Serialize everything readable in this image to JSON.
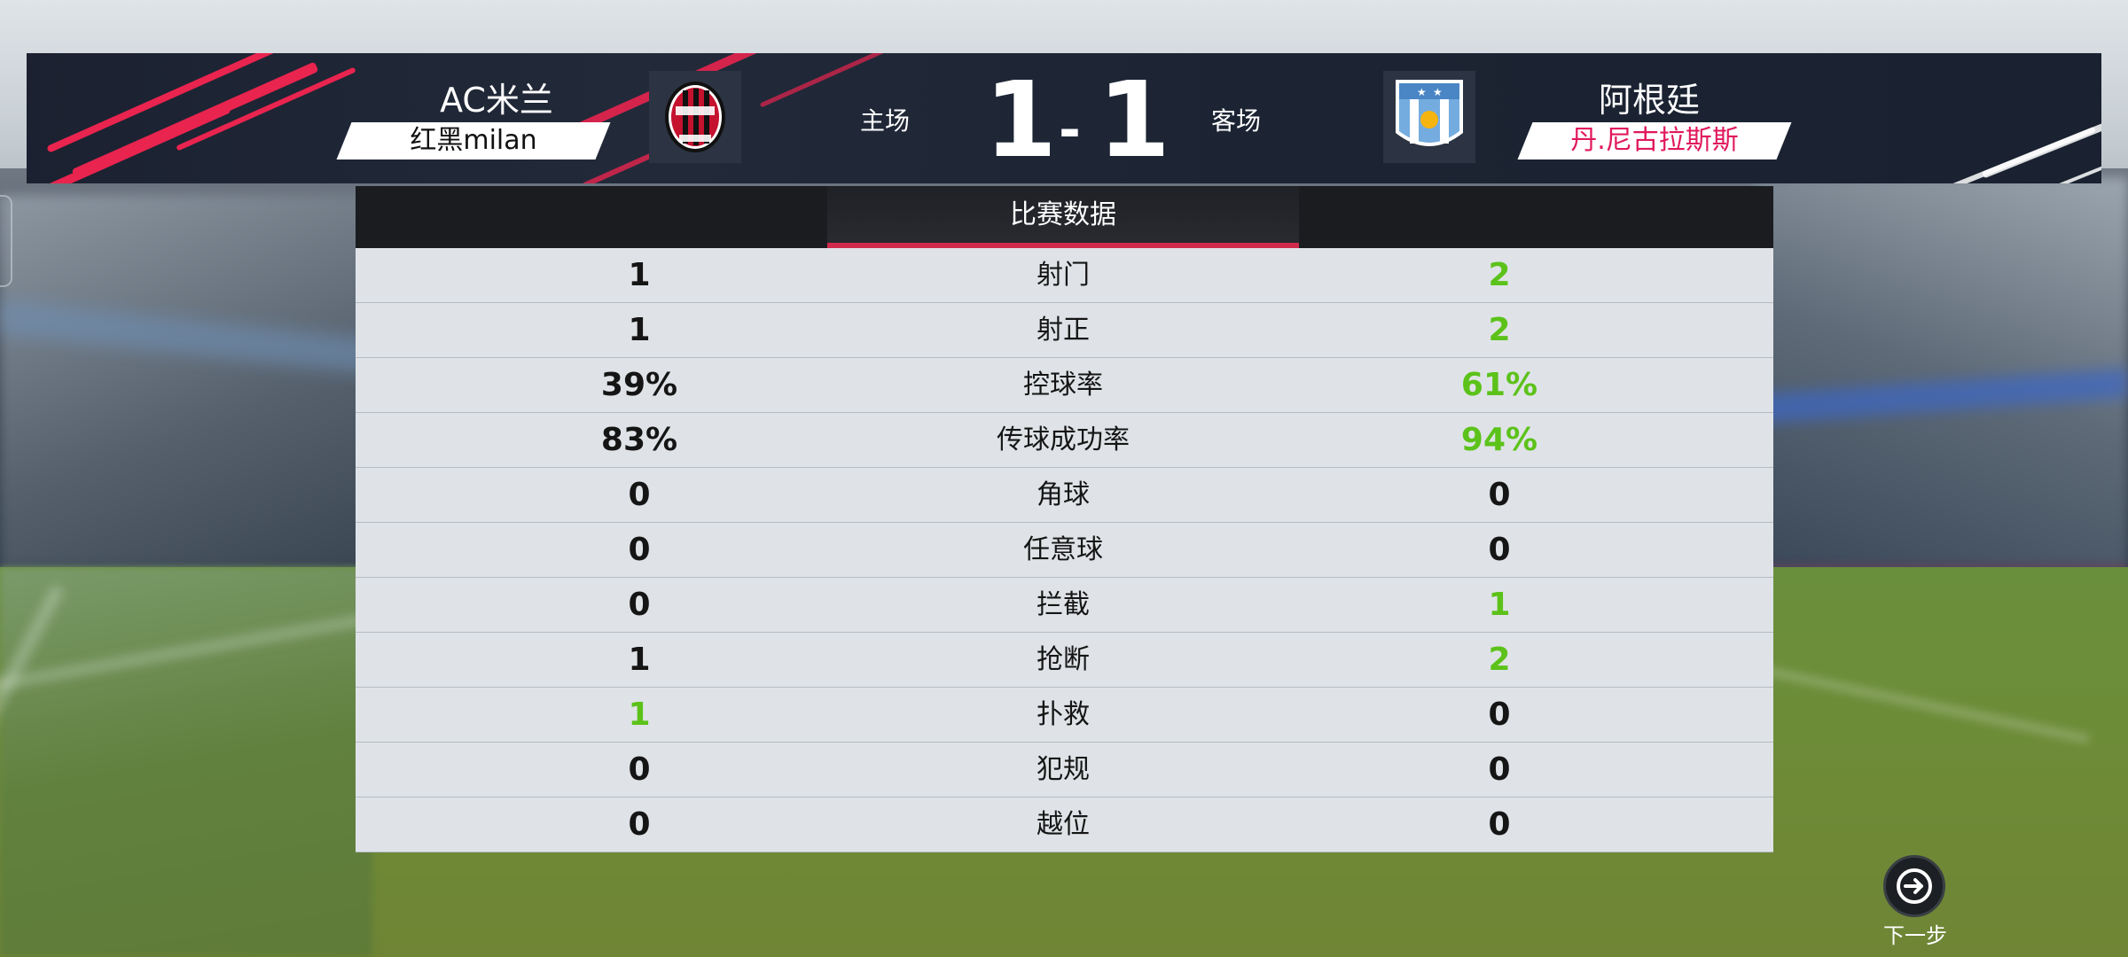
{
  "match": {
    "home": {
      "name": "AC米兰",
      "tag": "红黑milan",
      "side_label": "主场",
      "score": "1"
    },
    "away": {
      "name": "阿根廷",
      "tag": "丹.尼古拉斯斯",
      "side_label": "客场",
      "score": "1"
    },
    "score_separator": "-"
  },
  "stats": {
    "tab_label": "比赛数据",
    "rows": [
      {
        "label": "射门",
        "home": "1",
        "away": "2",
        "winner": "away"
      },
      {
        "label": "射正",
        "home": "1",
        "away": "2",
        "winner": "away"
      },
      {
        "label": "控球率",
        "home": "39%",
        "away": "61%",
        "winner": "away"
      },
      {
        "label": "传球成功率",
        "home": "83%",
        "away": "94%",
        "winner": "away"
      },
      {
        "label": "角球",
        "home": "0",
        "away": "0",
        "winner": "none"
      },
      {
        "label": "任意球",
        "home": "0",
        "away": "0",
        "winner": "none"
      },
      {
        "label": "拦截",
        "home": "0",
        "away": "1",
        "winner": "away"
      },
      {
        "label": "抢断",
        "home": "1",
        "away": "2",
        "winner": "away"
      },
      {
        "label": "扑救",
        "home": "1",
        "away": "0",
        "winner": "home"
      },
      {
        "label": "犯规",
        "home": "0",
        "away": "0",
        "winner": "none"
      },
      {
        "label": "越位",
        "home": "0",
        "away": "0",
        "winner": "none"
      }
    ]
  },
  "next": {
    "label": "下一步",
    "icon": "arrow-right-icon"
  },
  "icons": {
    "home_crest": "ac-milan-crest-icon",
    "away_crest": "argentina-crest-icon"
  },
  "colors": {
    "win": "#5cc21a",
    "accent": "#d02a4c",
    "away_tag": "#e0185c"
  }
}
